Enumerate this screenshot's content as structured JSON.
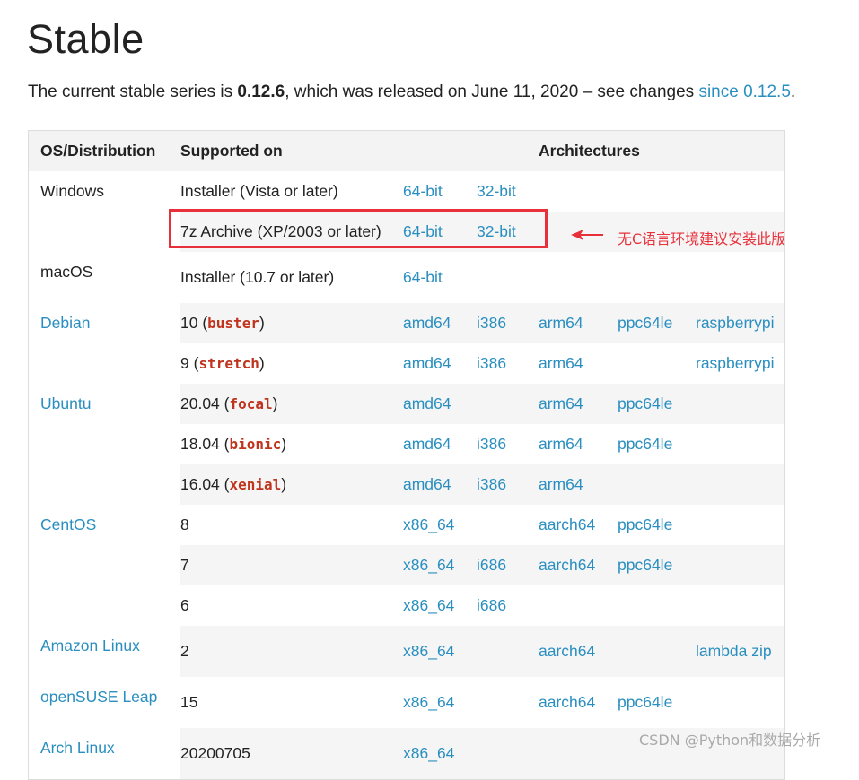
{
  "page": {
    "title": "Stable",
    "intro": {
      "prefix": "The current stable series is ",
      "version": "0.12.6",
      "middle": ", which was released on June 11, 2020 – see changes ",
      "link": "since 0.12.5",
      "suffix": "."
    }
  },
  "table": {
    "headers": [
      "OS/Distribution",
      "Supported on",
      "Architectures"
    ],
    "rows": [
      {
        "os": "Windows",
        "pre": "Installer (Vista or later)",
        "code": "",
        "post": "",
        "a1": "64-bit",
        "a2": "32-bit",
        "a3": "",
        "a4": "",
        "a5": ""
      },
      {
        "os": "",
        "pre": "7z Archive (XP/2003 or later)",
        "code": "",
        "post": "",
        "a1": "64-bit",
        "a2": "32-bit",
        "a3": "",
        "a4": "",
        "a5": ""
      },
      {
        "os": "macOS",
        "pre": "Installer (10.7 or later)",
        "code": "",
        "post": "",
        "a1": "64-bit",
        "a2": "",
        "a3": "",
        "a4": "",
        "a5": ""
      },
      {
        "os": "Debian",
        "pre": "10 (",
        "code": "buster",
        "post": ")",
        "a1": "amd64",
        "a2": "i386",
        "a3": "arm64",
        "a4": "ppc64le",
        "a5": "raspberrypi"
      },
      {
        "os": "",
        "pre": "9 (",
        "code": "stretch",
        "post": ")",
        "a1": "amd64",
        "a2": "i386",
        "a3": "arm64",
        "a4": "",
        "a5": "raspberrypi"
      },
      {
        "os": "Ubuntu",
        "pre": "20.04 (",
        "code": "focal",
        "post": ")",
        "a1": "amd64",
        "a2": "",
        "a3": "arm64",
        "a4": "ppc64le",
        "a5": ""
      },
      {
        "os": "",
        "pre": "18.04 (",
        "code": "bionic",
        "post": ")",
        "a1": "amd64",
        "a2": "i386",
        "a3": "arm64",
        "a4": "ppc64le",
        "a5": ""
      },
      {
        "os": "",
        "pre": "16.04 (",
        "code": "xenial",
        "post": ")",
        "a1": "amd64",
        "a2": "i386",
        "a3": "arm64",
        "a4": "",
        "a5": ""
      },
      {
        "os": "CentOS",
        "pre": "8",
        "code": "",
        "post": "",
        "a1": "x86_64",
        "a2": "",
        "a3": "aarch64",
        "a4": "ppc64le",
        "a5": ""
      },
      {
        "os": "",
        "pre": "7",
        "code": "",
        "post": "",
        "a1": "x86_64",
        "a2": "i686",
        "a3": "aarch64",
        "a4": "ppc64le",
        "a5": ""
      },
      {
        "os": "",
        "pre": "6",
        "code": "",
        "post": "",
        "a1": "x86_64",
        "a2": "i686",
        "a3": "",
        "a4": "",
        "a5": ""
      },
      {
        "os": "Amazon Linux",
        "pre": "2",
        "code": "",
        "post": "",
        "a1": "x86_64",
        "a2": "",
        "a3": "aarch64",
        "a4": "",
        "a5": "lambda zip"
      },
      {
        "os": "openSUSE Leap",
        "pre": "15",
        "code": "",
        "post": "",
        "a1": "x86_64",
        "a2": "",
        "a3": "aarch64",
        "a4": "ppc64le",
        "a5": ""
      },
      {
        "os": "Arch Linux",
        "pre": "20200705",
        "code": "",
        "post": "",
        "a1": "x86_64",
        "a2": "",
        "a3": "",
        "a4": "",
        "a5": ""
      }
    ]
  },
  "annotation": {
    "note": "无C语言环境建议安装此版",
    "color": "#e8303a"
  },
  "watermark": "CSDN @Python和数据分析",
  "colors": {
    "link": "#2a8fc0",
    "code": "#c0341d",
    "header_bg": "#f3f3f3",
    "stripe_bg": "#f5f5f5"
  }
}
